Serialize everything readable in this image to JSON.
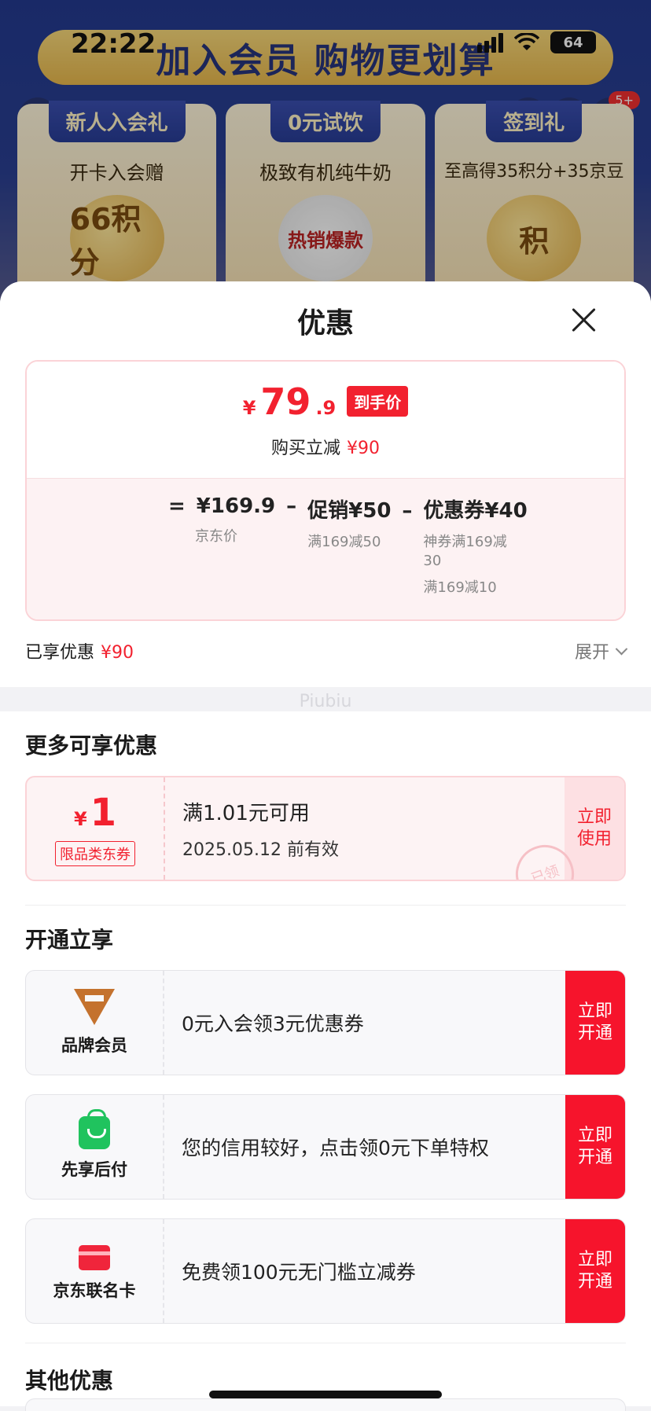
{
  "status": {
    "time": "22:22",
    "battery": "64"
  },
  "background": {
    "banner_title": "加入会员 购物更划算",
    "badge": "5+",
    "cards": [
      {
        "tag": "新人入会礼",
        "sub": "开卡入会赠",
        "art": "66积分"
      },
      {
        "tag": "0元试饮",
        "sub": "极致有机纯牛奶",
        "art": "热销爆款"
      },
      {
        "tag": "签到礼",
        "sub": "至高得35积分+35京豆",
        "art": "积"
      }
    ]
  },
  "sheet": {
    "title": "优惠",
    "price": {
      "yen": "¥",
      "int": "79",
      "dec": ".9",
      "tag": "到手价",
      "instant_label": "购买立减",
      "instant_value": "¥90"
    },
    "calc": {
      "eq": "=",
      "minus": "–",
      "jd_price": "¥169.9",
      "jd_label": "京东价",
      "promo": "促销¥50",
      "promo_sub": "满169减50",
      "coupon": "优惠券¥40",
      "coupon_sub1": "神券满169减30",
      "coupon_sub2": "满169减10"
    },
    "enjoyed_label": "已享优惠",
    "enjoyed_value": "¥90",
    "expand": "展开",
    "watermark": "Piubiu"
  },
  "more": {
    "title": "更多可享优惠",
    "coupon": {
      "yen": "¥",
      "amount": "1",
      "type": "限品类东券",
      "condition": "满1.01元可用",
      "valid": "2025.05.12 前有效",
      "action": "立即使用",
      "stamp": "已领"
    }
  },
  "open": {
    "title": "开通立享",
    "items": [
      {
        "name": "品牌会员",
        "desc": "0元入会领3元优惠券",
        "action": "立即开通"
      },
      {
        "name": "先享后付",
        "desc": "您的信用较好，点击领0元下单特权",
        "action": "立即开通"
      },
      {
        "name": "京东联名卡",
        "desc": "免费领100元无门槛立减券",
        "action": "立即开通"
      }
    ]
  },
  "other": {
    "title": "其他优惠"
  },
  "colors": {
    "accent_red": "#f2212f",
    "button_red": "#f6142c",
    "member_gold": "#c4722e",
    "pay_green": "#20c35e"
  }
}
